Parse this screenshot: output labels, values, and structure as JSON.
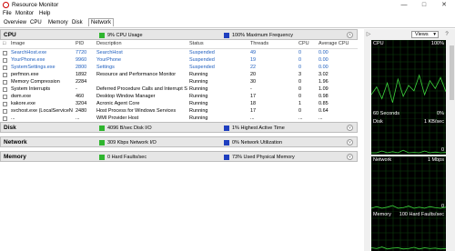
{
  "window": {
    "title": "Resource Monitor"
  },
  "menu": [
    "File",
    "Monitor",
    "Help"
  ],
  "tabs": [
    "Overview",
    "CPU",
    "Memory",
    "Disk",
    "Network"
  ],
  "colors": {
    "green": "#2fb52f",
    "blue": "#1f3fbf",
    "graph_bg": "#000000",
    "graph_line": "#3cd43c"
  },
  "cpu": {
    "label": "CPU",
    "usage": "9% CPU Usage",
    "freq": "100% Maximum Frequency",
    "columns": {
      "image": "Image",
      "pid": "PID",
      "desc": "Description",
      "status": "Status",
      "threads": "Threads",
      "cpu": "CPU",
      "avg": "Average CPU"
    },
    "rows": [
      {
        "image": "SearchHost.exe",
        "pid": "7720",
        "desc": "SearchHost",
        "status": "Suspended",
        "threads": "49",
        "cpu": "0",
        "avg": "0.00",
        "suspended": true
      },
      {
        "image": "YourPhone.exe",
        "pid": "9960",
        "desc": "YourPhone",
        "status": "Suspended",
        "threads": "19",
        "cpu": "0",
        "avg": "0.00",
        "suspended": true
      },
      {
        "image": "SystemSettings.exe",
        "pid": "2800",
        "desc": "Settings",
        "status": "Suspended",
        "threads": "22",
        "cpu": "0",
        "avg": "0.00",
        "suspended": true
      },
      {
        "image": "perfmon.exe",
        "pid": "1892",
        "desc": "Resource and Performance Monitor",
        "status": "Running",
        "threads": "20",
        "cpu": "3",
        "avg": "3.02",
        "suspended": false
      },
      {
        "image": "Memory Compression",
        "pid": "2284",
        "desc": "",
        "status": "Running",
        "threads": "30",
        "cpu": "0",
        "avg": "1.96",
        "suspended": false
      },
      {
        "image": "System Interrupts",
        "pid": "-",
        "desc": "Deferred Procedure Calls and Interrupt Service...",
        "status": "Running",
        "threads": "-",
        "cpu": "0",
        "avg": "1.09",
        "suspended": false
      },
      {
        "image": "dwm.exe",
        "pid": "460",
        "desc": "Desktop Window Manager",
        "status": "Running",
        "threads": "17",
        "cpu": "0",
        "avg": "0.98",
        "suspended": false
      },
      {
        "image": "kakore.exe",
        "pid": "3204",
        "desc": "Acronic Agent Core",
        "status": "Running",
        "threads": "18",
        "cpu": "1",
        "avg": "0.85",
        "suspended": false
      },
      {
        "image": "svchost.exe (LocalServiceNo...",
        "pid": "2480",
        "desc": "Host Process for Windows Services",
        "status": "Running",
        "threads": "17",
        "cpu": "0",
        "avg": "0.64",
        "suspended": false
      },
      {
        "image": "...",
        "pid": "...",
        "desc": "WMI Provider Host",
        "status": "Running",
        "threads": "...",
        "cpu": "...",
        "avg": "...",
        "suspended": false
      }
    ]
  },
  "disk": {
    "label": "Disk",
    "io": "4096 B/sec Disk I/O",
    "active": "1% Highest Active Time"
  },
  "network": {
    "label": "Network",
    "io": "309 Kbps Network I/O",
    "util": "0% Network Utilization"
  },
  "memory": {
    "label": "Memory",
    "faults": "0 Hard Faults/sec",
    "used": "73% Used Physical Memory"
  },
  "right": {
    "views": "Views",
    "graphs": [
      {
        "title": "CPU",
        "max": "100%",
        "foot_left": "60 Seconds",
        "foot_right": "0%"
      },
      {
        "title": "Disk",
        "max": "1 KB/sec",
        "foot_left": "",
        "foot_right": "0"
      },
      {
        "title": "Network",
        "max": "1 Mbps",
        "foot_left": "",
        "foot_right": "0"
      },
      {
        "title": "Memory",
        "max": "100 Hard Faults/sec",
        "foot_left": "",
        "foot_right": ""
      }
    ]
  }
}
